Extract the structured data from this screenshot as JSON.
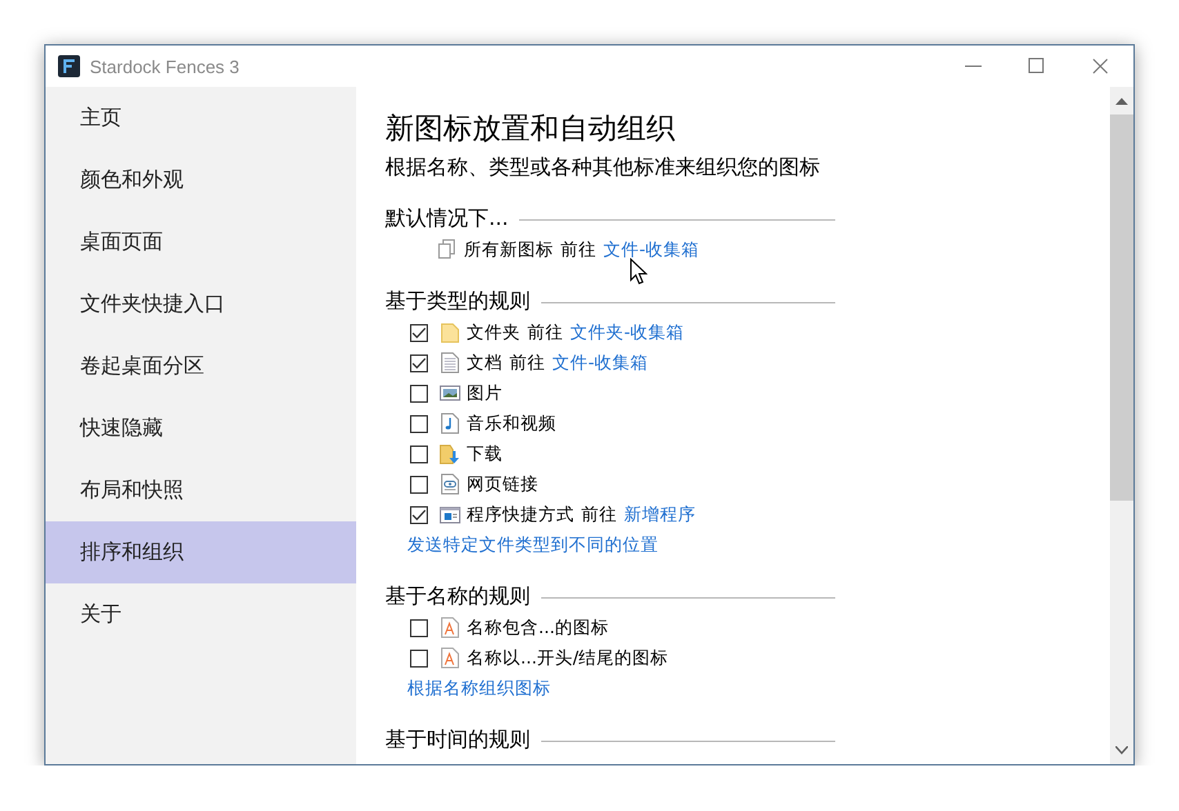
{
  "window": {
    "title": "Stardock Fences 3"
  },
  "sidebar": {
    "items": [
      {
        "label": "主页",
        "selected": false
      },
      {
        "label": "颜色和外观",
        "selected": false
      },
      {
        "label": "桌面页面",
        "selected": false
      },
      {
        "label": "文件夹快捷入口",
        "selected": false
      },
      {
        "label": "卷起桌面分区",
        "selected": false
      },
      {
        "label": "快速隐藏",
        "selected": false
      },
      {
        "label": "布局和快照",
        "selected": false
      },
      {
        "label": "排序和组织",
        "selected": true
      },
      {
        "label": "关于",
        "selected": false
      }
    ]
  },
  "content": {
    "title": "新图标放置和自动组织",
    "subtitle": "根据名称、类型或各种其他标准来组织您的图标",
    "sections": [
      {
        "title": "默认情况下...",
        "rows": [
          {
            "kind": "copy",
            "text": "所有新图标",
            "prep": "前往",
            "link": "文件-收集箱"
          }
        ]
      },
      {
        "title": "基于类型的规则",
        "rows": [
          {
            "kind": "folder",
            "checked": true,
            "text": "文件夹",
            "prep": "前往",
            "link": "文件夹-收集箱"
          },
          {
            "kind": "document",
            "checked": true,
            "text": "文档",
            "prep": "前往",
            "link": "文件-收集箱"
          },
          {
            "kind": "picture",
            "checked": false,
            "text": "图片"
          },
          {
            "kind": "music",
            "checked": false,
            "text": "音乐和视频"
          },
          {
            "kind": "download",
            "checked": false,
            "text": "下载"
          },
          {
            "kind": "weblink",
            "checked": false,
            "text": "网页链接"
          },
          {
            "kind": "shortcut",
            "checked": true,
            "text": "程序快捷方式",
            "prep": "前往",
            "link": "新增程序"
          }
        ],
        "link": "发送特定文件类型到不同的位置"
      },
      {
        "title": "基于名称的规则",
        "rows": [
          {
            "kind": "textfile",
            "checked": false,
            "text": "名称包含...的图标"
          },
          {
            "kind": "textfile",
            "checked": false,
            "text": "名称以...开头/结尾的图标"
          }
        ],
        "link": "根据名称组织图标"
      },
      {
        "title": "基于时间的规则"
      }
    ]
  }
}
